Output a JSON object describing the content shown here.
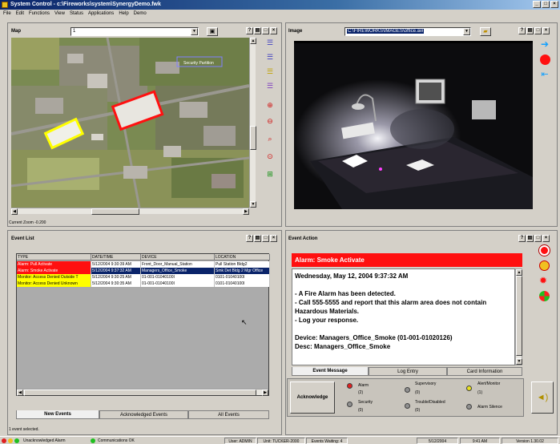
{
  "window": {
    "title": "System Control - c:\\Fireworks\\system\\SynergyDemo.fwk"
  },
  "menu": [
    "File",
    "Edit",
    "Functions",
    "View",
    "Status",
    "Applications",
    "Help",
    "Demo"
  ],
  "map_panel": {
    "title": "Map",
    "selector_value": "1",
    "map_label": "Security Partition",
    "zoom_status": "Current Zoom -0.200"
  },
  "image_panel": {
    "title": "Image",
    "path_value": "C:\\FIREWORKS\\IMAGES\\office.avi"
  },
  "event_list": {
    "title": "Event List",
    "columns": [
      "TYPE",
      "DATE/TIME",
      "DEVICE",
      "LOCATION"
    ],
    "rows": [
      {
        "type": "Alarm: Pull Activate",
        "datetime": "5/12/2004 9:30:39 AM",
        "device": "Front_Door_Manual_Station",
        "location": "Pull Station Bldg2",
        "type_color": "#ff1010"
      },
      {
        "type": "Alarm: Smoke Activate",
        "datetime": "5/12/2004 9:37:32 AM",
        "device": "Managers_Office_Smoke",
        "location": "Smk Det Bldg 2 Mgr Office",
        "type_color": "#ff1010"
      },
      {
        "type": "Monitor: Access Denied Outside T",
        "datetime": "5/12/2004 9:30:25 AM",
        "device": "01-001-01040100I",
        "location": "0101-01040100I",
        "type_color": "#ffff00"
      },
      {
        "type": "Monitor: Access Denied Unknown",
        "datetime": "5/12/2004 9:30:35 AM",
        "device": "01-001-01040100I",
        "location": "0101-01040100I",
        "type_color": "#ffff00"
      }
    ],
    "tabs": [
      "New Events",
      "Acknowledged Events",
      "All Events"
    ],
    "selection_status": "1 event selected."
  },
  "event_action": {
    "title": "Event Action",
    "header": "Alarm: Smoke Activate",
    "lines": [
      "Wednesday, May 12, 2004 9:37:32 AM",
      "",
      "-   A Fire Alarm has been detected.",
      "-   Call 555-5555 and report that this alarm area does not contain Hazardous Materials.",
      "-   Log your response.",
      "",
      "Device: Managers_Office_Smoke (01-001-01020126)",
      "Desc: Managers_Office_Smoke"
    ],
    "tabs": [
      "Event Message",
      "Log Entry",
      "Card Information"
    ],
    "acknowledge_label": "Acknowledge",
    "statuses": [
      {
        "label": "Alarm",
        "count": "(2)",
        "color": "#e02020"
      },
      {
        "label": "Supervisory",
        "count": "(0)",
        "color": "#909090"
      },
      {
        "label": "Alert/Monitor",
        "count": "(1)",
        "color": "#e8e020"
      },
      {
        "label": "Security",
        "count": "(0)",
        "color": "#909090"
      },
      {
        "label": "Trouble/Disabled",
        "count": "(0)",
        "color": "#909090"
      },
      {
        "label": "Alarm Silence",
        "count": "",
        "color": "#909090"
      }
    ]
  },
  "statusbar": {
    "unack_alarm": "Unacknowledged Alarm",
    "comms": "Communications OK",
    "user": "User: ADMIN",
    "unit": "Unit: TUCKER-2000",
    "events_waiting": "Events Waiting: 4",
    "date": "5/12/2004",
    "time": "9:41 AM",
    "version": "Version 1.30.02"
  },
  "colors": {
    "title_bar": "#0a246a",
    "alarm_red": "#ff1010",
    "monitor_yellow": "#ffff00",
    "selected_row": "#0a246a"
  }
}
